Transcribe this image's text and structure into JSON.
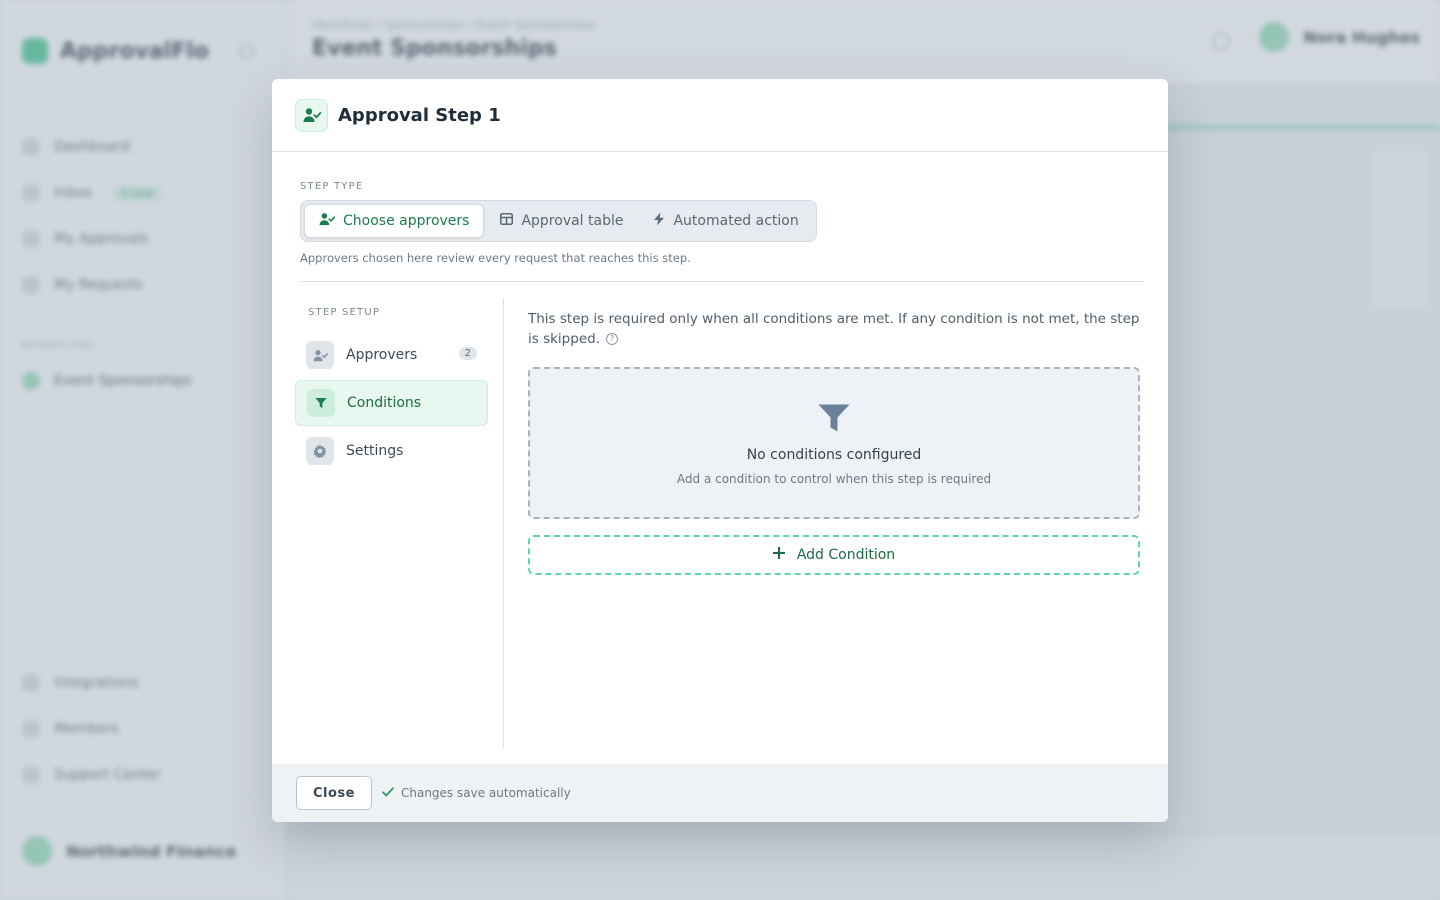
{
  "background": {
    "app_name": "ApprovalFlo",
    "nav": [
      {
        "label": "Dashboard"
      },
      {
        "label": "Inbox",
        "badge": "3 new"
      },
      {
        "label": "My Approvals"
      },
      {
        "label": "My Requests"
      }
    ],
    "section_label": "WORKFLOWS",
    "flow_item": "Event Sponsorships",
    "bottom_nav": [
      {
        "label": "Integrations"
      },
      {
        "label": "Members"
      },
      {
        "label": "Support Center"
      }
    ],
    "workspace": "Northwind Finance",
    "breadcrumbs": "Workflows  /  Sponsorships  /  Event Sponsorships",
    "page_title": "Event Sponsorships",
    "user_name": "Nora Hughes"
  },
  "modal": {
    "title": "Approval Step 1",
    "step_type": {
      "label": "STEP TYPE",
      "options": [
        {
          "label": "Choose approvers",
          "icon": "user-check-icon",
          "selected": true
        },
        {
          "label": "Approval table",
          "icon": "table-icon",
          "selected": false
        },
        {
          "label": "Automated action",
          "icon": "lightning-icon",
          "selected": false
        }
      ],
      "note": "Approvers chosen here review every request that reaches this step."
    },
    "setup": {
      "label": "STEP SETUP",
      "items": [
        {
          "label": "Approvers",
          "count": "2",
          "icon": "user-check-icon",
          "active": false
        },
        {
          "label": "Conditions",
          "icon": "filter-icon",
          "active": true
        },
        {
          "label": "Settings",
          "icon": "gear-icon",
          "active": false
        }
      ]
    },
    "conditions": {
      "description": "This step is required only when all conditions are met. If any condition is not met, the step is skipped.",
      "help_glyph": "?",
      "empty_title": "No conditions configured",
      "empty_subtitle": "Add a condition to control when this step is required",
      "add_label": "Add Condition"
    },
    "footer": {
      "close_label": "Close",
      "saved_text": "Changes save automatically"
    }
  },
  "colors": {
    "accent": "#1d7a52",
    "accent_light": "#e8f7ef",
    "accent_dashed": "#5fd4a8",
    "empty_icon": "#6b8099"
  }
}
